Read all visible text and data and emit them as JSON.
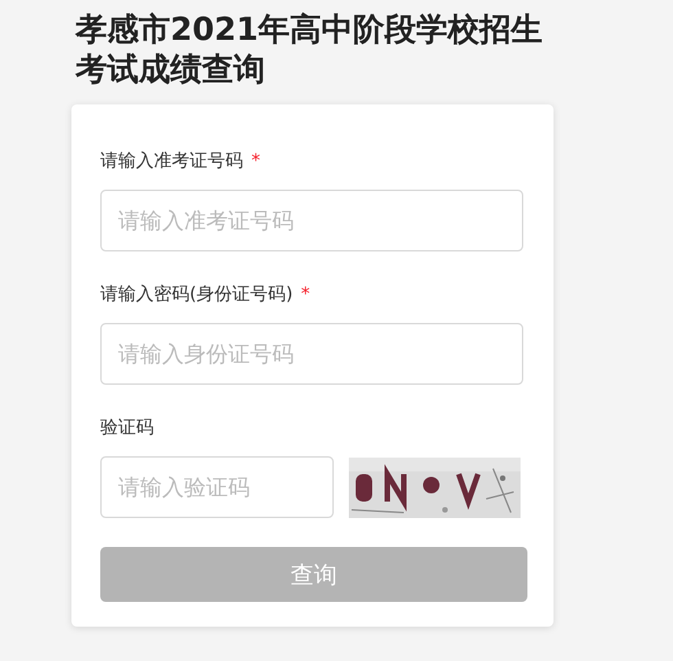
{
  "title": "孝感市2021年高中阶段学校招生考试成绩查询",
  "fields": [
    {
      "kind": "text",
      "label": "请输入准考证号码",
      "required_mark": "*",
      "placeholder": "请输入准考证号码"
    },
    {
      "kind": "text",
      "label": "请输入密码(身份证号码)",
      "required_mark": "*",
      "placeholder": "请输入身份证号码"
    },
    {
      "kind": "captcha",
      "label": "验证码",
      "placeholder": "请输入验证码"
    }
  ],
  "submit": {
    "label": "查询",
    "disabled": true
  }
}
